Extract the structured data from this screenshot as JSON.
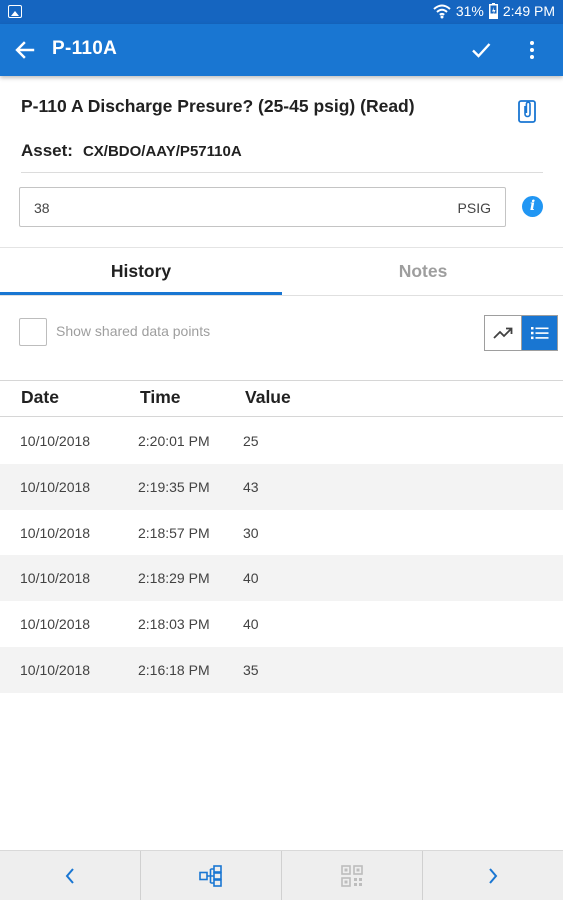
{
  "status_bar": {
    "battery_percent": "31%",
    "time": "2:49 PM",
    "icons": [
      "image-notification-icon",
      "wifi-icon",
      "battery-icon"
    ]
  },
  "app_bar": {
    "title": "P-110A",
    "icons": [
      "back-arrow-icon",
      "checkmark-icon",
      "more-vert-icon"
    ]
  },
  "reading": {
    "question": "P-110 A Discharge Presure? (25-45 psig) (Read)",
    "asset_label": "Asset:",
    "asset_value": "CX/BDO/AAY/P57110A",
    "value": "38",
    "unit": "PSIG",
    "info_glyph": "i"
  },
  "tabs": [
    {
      "label": "History",
      "active": true
    },
    {
      "label": "Notes",
      "active": false
    }
  ],
  "options": {
    "shared_label": "Show shared data points",
    "shared_checked": false,
    "view_mode": "list"
  },
  "table": {
    "columns": [
      "Date",
      "Time",
      "Value"
    ],
    "rows": [
      [
        "10/10/2018",
        "2:20:01 PM",
        "25"
      ],
      [
        "10/10/2018",
        "2:19:35 PM",
        "43"
      ],
      [
        "10/10/2018",
        "2:18:57 PM",
        "30"
      ],
      [
        "10/10/2018",
        "2:18:29 PM",
        "40"
      ],
      [
        "10/10/2018",
        "2:18:03 PM",
        "40"
      ],
      [
        "10/10/2018",
        "2:16:18 PM",
        "35"
      ]
    ]
  },
  "bottom_nav": [
    "prev-chevron-icon",
    "hierarchy-icon",
    "qr-scan-icon",
    "next-chevron-icon"
  ],
  "colors": {
    "primary": "#1976d2",
    "status_bar": "#1565c0",
    "info_blue": "#2196f3",
    "inactive_text": "#9e9e9e"
  }
}
